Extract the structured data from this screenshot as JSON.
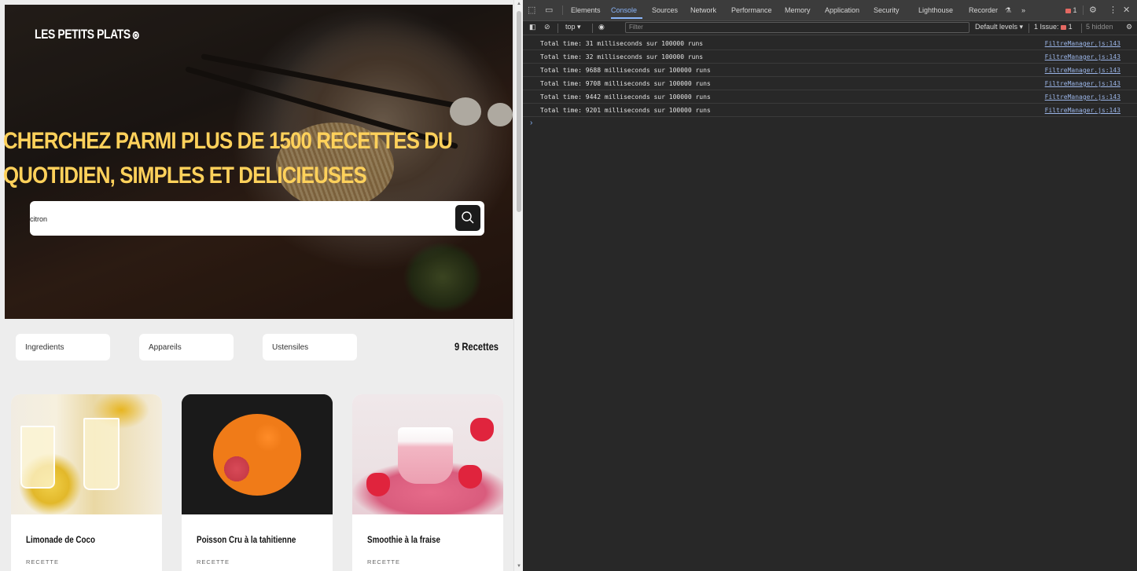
{
  "site": {
    "logo": "LES PETITS PLATS",
    "headline": "CHERCHEZ PARMI PLUS DE 1500 RECETTES DU QUOTIDIEN, SIMPLES ET DELICIEUSES",
    "search": {
      "value": "citron"
    },
    "filters": [
      "Ingredients",
      "Appareils",
      "Ustensiles"
    ],
    "recipe_count": "9 Recettes",
    "cards": [
      {
        "title": "Limonade de Coco",
        "subtitle": "RECETTE"
      },
      {
        "title": "Poisson Cru à la tahitienne",
        "subtitle": "RECETTE"
      },
      {
        "title": "Smoothie à la fraise",
        "subtitle": "RECETTE"
      }
    ]
  },
  "devtools": {
    "tabs": [
      "Elements",
      "Console",
      "Sources",
      "Network",
      "Performance",
      "Memory",
      "Application",
      "Security",
      "Lighthouse",
      "Recorder"
    ],
    "active_tab": "Console",
    "more_tabs": "»",
    "error_count": "1",
    "toolbar": {
      "context": "top",
      "filter_placeholder": "Filter",
      "levels": "Default levels",
      "issues_label": "1 Issue:",
      "issues_count": "1",
      "hidden": "5 hidden"
    },
    "console": [
      {
        "message": "Total time: 31 milliseconds sur 100000 runs",
        "source": "FiltreManager.js:143"
      },
      {
        "message": "Total time: 32 milliseconds sur 100000 runs",
        "source": "FiltreManager.js:143"
      },
      {
        "message": "Total time: 9688 milliseconds sur 100000 runs",
        "source": "FiltreManager.js:143"
      },
      {
        "message": "Total time: 9708 milliseconds sur 100000 runs",
        "source": "FiltreManager.js:143"
      },
      {
        "message": "Total time: 9442 milliseconds sur 100000 runs",
        "source": "FiltreManager.js:143"
      },
      {
        "message": "Total time: 9201 milliseconds sur 100000 runs",
        "source": "FiltreManager.js:143"
      }
    ],
    "prompt_symbol": "›"
  },
  "colors": {
    "headline": "#ffd15b",
    "devtools_bg": "#282828",
    "link": "#9ab4e6",
    "active_tab": "#8ab4f8"
  }
}
